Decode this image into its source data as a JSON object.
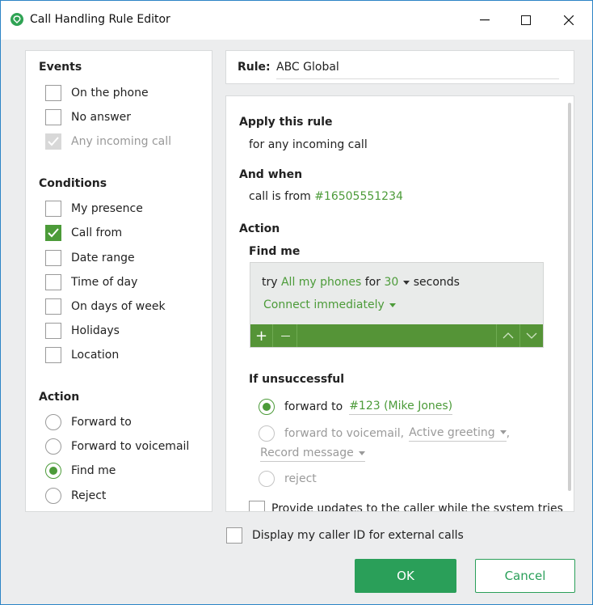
{
  "window": {
    "title": "Call Handling Rule Editor",
    "minimize": "—",
    "maximize": "☐",
    "close": "✕"
  },
  "sidebar": {
    "events": {
      "title": "Events",
      "items": [
        {
          "label": "On the phone",
          "checked": false,
          "disabled": false
        },
        {
          "label": "No answer",
          "checked": false,
          "disabled": false
        },
        {
          "label": "Any incoming call",
          "checked": true,
          "disabled": true
        }
      ]
    },
    "conditions": {
      "title": "Conditions",
      "items": [
        {
          "label": "My presence",
          "checked": false
        },
        {
          "label": "Call from",
          "checked": true
        },
        {
          "label": "Date range",
          "checked": false
        },
        {
          "label": "Time of day",
          "checked": false
        },
        {
          "label": "On days of week",
          "checked": false
        },
        {
          "label": "Holidays",
          "checked": false
        },
        {
          "label": "Location",
          "checked": false
        }
      ]
    },
    "action": {
      "title": "Action",
      "items": [
        {
          "label": "Forward to",
          "selected": false
        },
        {
          "label": "Forward to voicemail",
          "selected": false
        },
        {
          "label": "Find me",
          "selected": true
        },
        {
          "label": "Reject",
          "selected": false
        }
      ]
    }
  },
  "rule": {
    "label": "Rule:",
    "value": "ABC Global"
  },
  "details": {
    "apply_title": "Apply this rule",
    "apply_text": "for any incoming call",
    "when_title": "And when",
    "when_prefix": "call is from",
    "when_value": "#16505551234",
    "action_title": "Action",
    "findme_title": "Find me",
    "try_prefix": "try",
    "try_target": "All my phones",
    "for_word": "for",
    "seconds_value": "30",
    "seconds_word": "seconds",
    "connect_option": "Connect immediately",
    "add_symbol": "+",
    "remove_symbol": "—",
    "unsuccessful_title": "If unsuccessful",
    "fwd_prefix": "forward to",
    "fwd_target": "#123 (Mike Jones)",
    "vm_prefix": "forward to voicemail,",
    "vm_greeting": "Active greeting",
    "vm_record": "Record message",
    "reject": "reject",
    "updates_text": "Provide updates to the caller while the system tries"
  },
  "footer": {
    "caller_id_text": "Display my caller ID for external calls",
    "ok": "OK",
    "cancel": "Cancel"
  },
  "colors": {
    "accent": "#4c9b39",
    "button": "#2a9f59"
  }
}
